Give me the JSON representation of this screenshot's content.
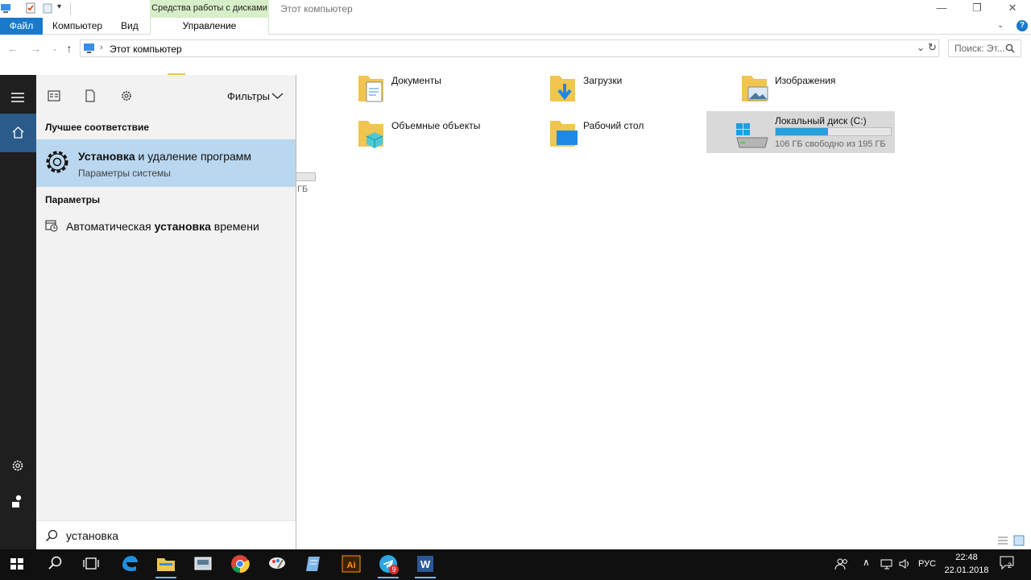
{
  "window": {
    "title": "Этот компьютер",
    "tools_group": "Средства работы с дисками",
    "controls": {
      "minimize": "—",
      "restore": "❐",
      "close": "✕"
    }
  },
  "ribbon": {
    "tabs": [
      "Файл",
      "Компьютер",
      "Вид",
      "Управление"
    ]
  },
  "address": {
    "path": "Этот компьютер",
    "search_placeholder": "Поиск: Эт..."
  },
  "folders": [
    {
      "name": "Документы",
      "icon": "documents-folder-icon"
    },
    {
      "name": "Загрузки",
      "icon": "downloads-folder-icon"
    },
    {
      "name": "Изображения",
      "icon": "pictures-folder-icon"
    },
    {
      "name": "Объемные объекты",
      "icon": "3d-objects-folder-icon"
    },
    {
      "name": "Рабочий стол",
      "icon": "desktop-folder-icon"
    }
  ],
  "drive": {
    "name": "Локальный диск (C:)",
    "free_text": "106 ГБ свободно из 195 ГБ",
    "used_fraction": 0.456
  },
  "partial_drive_text": "ГБ",
  "start": {
    "filters_label": "Фильтры",
    "best_match_header": "Лучшее соответствие",
    "best_title_bold": "Установка",
    "best_title_rest": " и удаление программ",
    "best_subtitle": "Параметры системы",
    "settings_header": "Параметры",
    "setting_prefix": "Автоматическая ",
    "setting_bold": "установка",
    "setting_suffix": " времени",
    "query": "установка"
  },
  "taskbar": {
    "time": "22:48",
    "date": "22.01.2018",
    "language": "РУС",
    "notifications": "2",
    "telegram_badge": "9",
    "apps": [
      "start",
      "search",
      "task-view",
      "edge",
      "explorer",
      "app",
      "chrome",
      "app",
      "app",
      "illustrator",
      "telegram",
      "word"
    ]
  },
  "colors": {
    "accent": "#1979ca",
    "selection": "#b9d7ef",
    "taskbar": "#101010",
    "drive_fill": "#26a0da"
  }
}
